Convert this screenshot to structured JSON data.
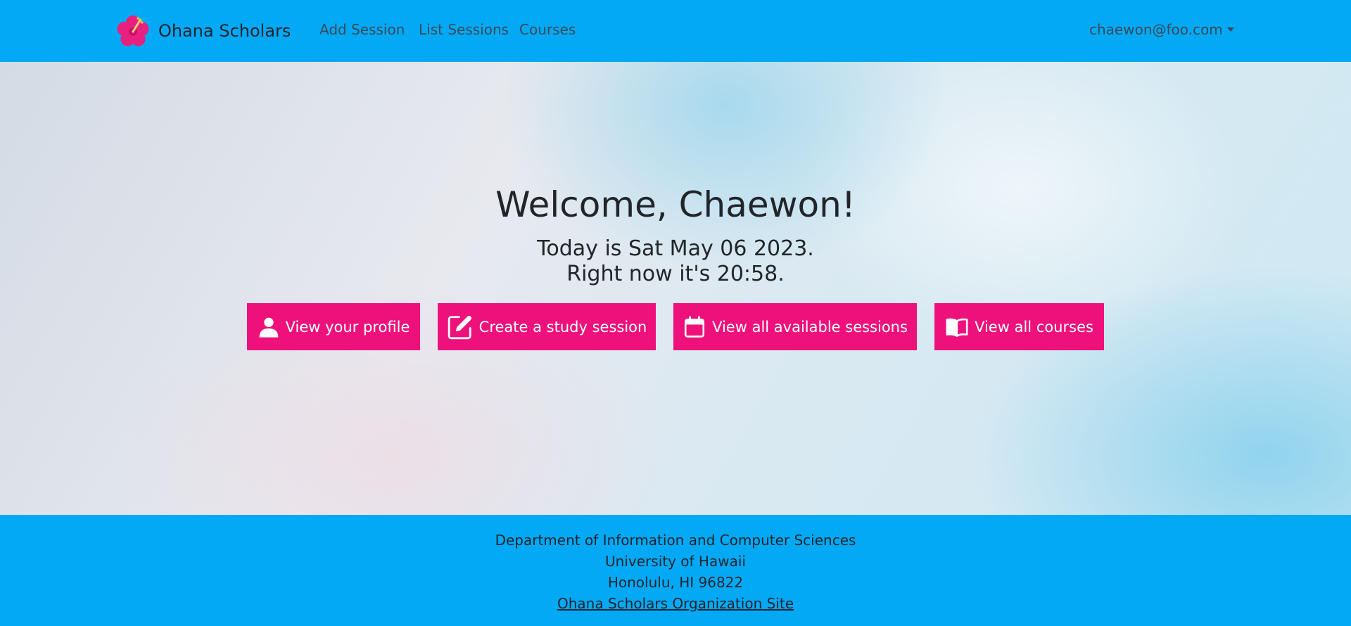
{
  "navbar": {
    "brand_name": "Ohana Scholars",
    "links": [
      {
        "label": "Add Session"
      },
      {
        "label": "List Sessions"
      },
      {
        "label": "Courses"
      }
    ],
    "user_email": "chaewon@foo.com"
  },
  "main": {
    "welcome": "Welcome, Chaewon!",
    "date_text": "Today is Sat May 06 2023.",
    "time_text": "Right now it's 20:58.",
    "buttons": [
      {
        "label": "View your profile",
        "icon": "person-icon"
      },
      {
        "label": "Create a study session",
        "icon": "edit-icon"
      },
      {
        "label": "View all available sessions",
        "icon": "calendar-icon"
      },
      {
        "label": "View all courses",
        "icon": "book-icon"
      }
    ]
  },
  "footer": {
    "lines": [
      "Department of Information and Computer Sciences",
      "University of Hawaii",
      "Honolulu, HI 96822"
    ],
    "link_label": "Ohana Scholars Organization Site"
  },
  "colors": {
    "navbar": "#03a9f4",
    "button": "#ee117b",
    "logo_flower": "#e8207e"
  }
}
